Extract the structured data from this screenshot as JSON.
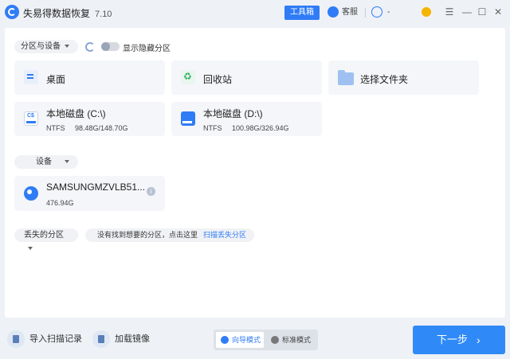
{
  "app": {
    "title": "失易得数据恢复",
    "version": "7.10"
  },
  "titlebar": {
    "toolbox_label": "工具箱",
    "service_label": "客服",
    "account_label": "-"
  },
  "filters": {
    "partition_label": "分区与设备",
    "show_hidden_label": "显示隐藏分区"
  },
  "locations": [
    {
      "title": "桌面",
      "icon": "desktop-icon"
    },
    {
      "title": "回收站",
      "icon": "recycle-bin-icon"
    },
    {
      "title": "选择文件夹",
      "icon": "folder-icon"
    }
  ],
  "disks": [
    {
      "title": "本地磁盘 (C:\\)",
      "fs": "NTFS",
      "usage": "98.48G/148.70G",
      "icon_text": "C$"
    },
    {
      "title": "本地磁盘 (D:\\)",
      "fs": "NTFS",
      "usage": "100.98G/326.94G"
    }
  ],
  "devices_section": {
    "label": "设备"
  },
  "devices": [
    {
      "title": "SAMSUNGMZVLB51...",
      "size": "476.94G",
      "info_icon": "i"
    }
  ],
  "lost_section": {
    "label": "丢失的分区",
    "hint": "没有找到想要的分区，点击这里",
    "link": "扫描丢失分区"
  },
  "bottom": {
    "import_label": "导入扫描记录",
    "mount_label": "加载镜像",
    "guide_mode_label": "向导模式",
    "standard_mode_label": "标准模式",
    "next_label": "下一步",
    "next_arrow": "›"
  },
  "colors": {
    "accent": "#2f7cf6",
    "panel_bg": "#ffffff",
    "app_bg": "#eef1f6"
  }
}
